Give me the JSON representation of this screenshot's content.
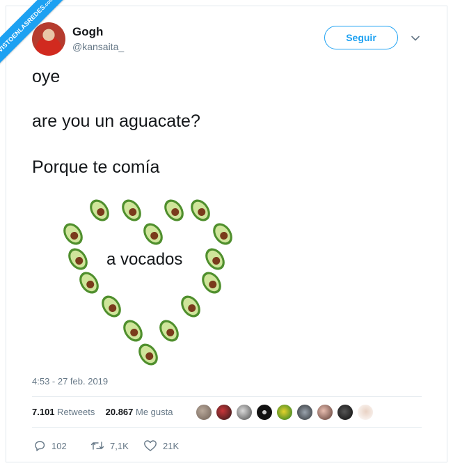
{
  "watermark": {
    "text": "VISTOENLASREDES",
    "suffix": ".com"
  },
  "user": {
    "name": "Gogh",
    "handle": "@kansaita_"
  },
  "follow_label": "Seguir",
  "tweet": {
    "lines": [
      "oye",
      "are you un aguacate?",
      "Porque te comía"
    ],
    "heart_caption": "a vocados"
  },
  "timestamp": "4:53 - 27 feb. 2019",
  "stats": {
    "retweets_count": "7.101",
    "retweets_label": "Retweets",
    "likes_count": "20.867",
    "likes_label": "Me gusta"
  },
  "actions": {
    "replies": "102",
    "retweets": "7,1K",
    "likes": "21K"
  },
  "colors": {
    "accent": "#1da1f2",
    "avocado_skin": "#4f8f2d",
    "avocado_flesh": "#cfe59a",
    "avocado_pit": "#7a3b1c"
  },
  "icons": [
    "chevron-down-icon",
    "avocado-icon",
    "reply-icon",
    "retweet-icon",
    "heart-icon"
  ]
}
